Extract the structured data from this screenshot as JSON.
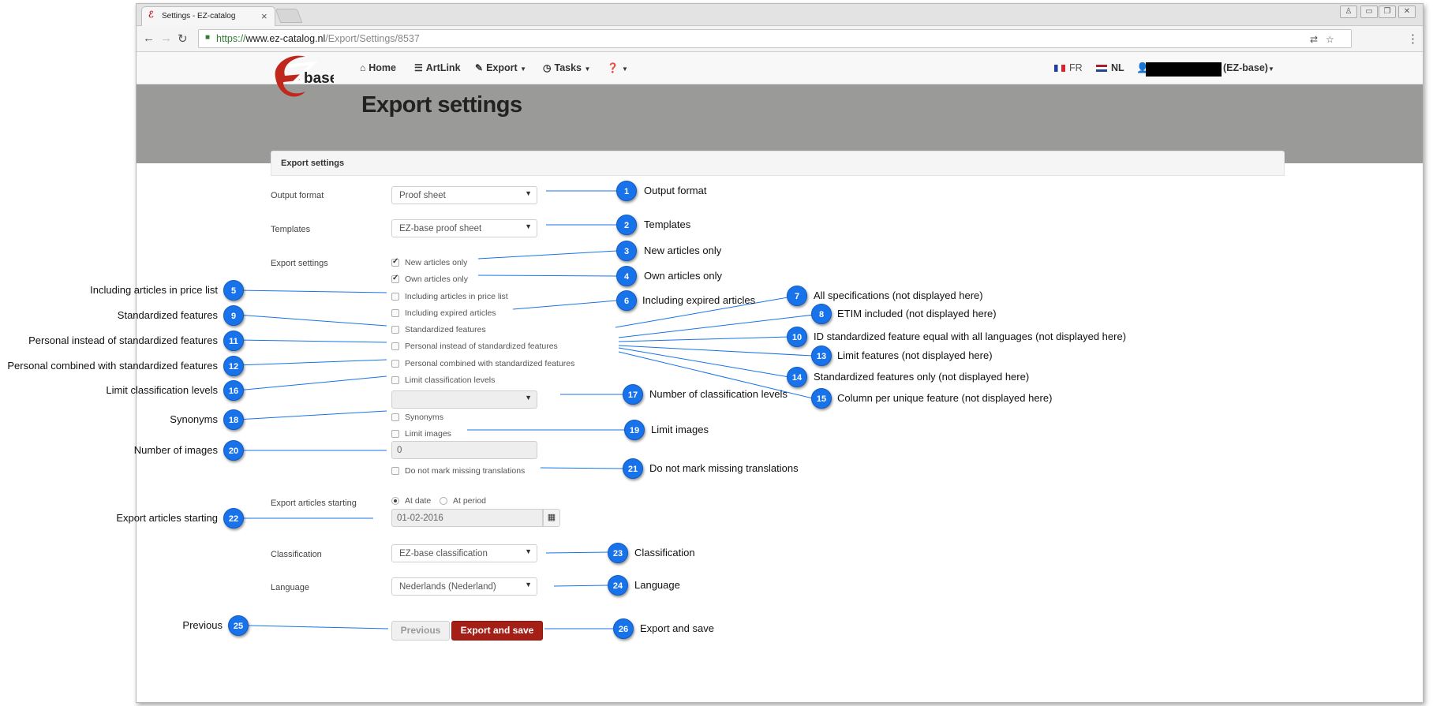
{
  "browser": {
    "tab_title": "Settings - EZ-catalog",
    "tab_close": "×",
    "url_https": "https://",
    "url_host": "www.ez-catalog.nl",
    "url_path": "/Export/Settings/8537"
  },
  "site": {
    "logo_text": "base",
    "nav": {
      "home": "Home",
      "artlink": "ArtLink",
      "export": "Export",
      "tasks": "Tasks",
      "help": ""
    },
    "lang_fr": "FR",
    "lang_nl": "NL",
    "user_suffix": "(EZ-base)"
  },
  "page": {
    "title": "Export settings",
    "panel_title": "Export settings"
  },
  "form": {
    "output_format_label": "Output format",
    "output_format_value": "Proof sheet",
    "templates_label": "Templates",
    "templates_value": "EZ-base proof sheet",
    "export_settings_label": "Export settings",
    "checkboxes": {
      "new_articles_only": {
        "label": "New articles only",
        "checked": true
      },
      "own_articles_only": {
        "label": "Own articles only",
        "checked": true
      },
      "including_price_list": {
        "label": "Including articles in price list",
        "checked": false
      },
      "including_expired": {
        "label": "Including expired articles",
        "checked": false
      },
      "standardized_features": {
        "label": "Standardized features",
        "checked": false
      },
      "personal_instead": {
        "label": "Personal instead of standardized features",
        "checked": false
      },
      "personal_combined": {
        "label": "Personal combined with standardized features",
        "checked": false
      },
      "limit_classification": {
        "label": "Limit classification levels",
        "checked": false
      },
      "synonyms": {
        "label": "Synonyms",
        "checked": false
      },
      "limit_images": {
        "label": "Limit images",
        "checked": false
      },
      "no_mark_missing": {
        "label": "Do not mark missing translations",
        "checked": false
      }
    },
    "classification_levels_value": "",
    "number_of_images_value": "0",
    "export_articles_starting_label": "Export articles starting",
    "radio_at_date": "At date",
    "radio_at_period": "At period",
    "date_value": "01-02-2016",
    "classification_label": "Classification",
    "classification_value": "EZ-base classification",
    "language_label": "Language",
    "language_value": "Nederlands (Nederland)",
    "previous_label": "Previous",
    "export_label": "Export and save"
  },
  "callouts": {
    "c1": {
      "num": "1",
      "text": "Output format"
    },
    "c2": {
      "num": "2",
      "text": "Templates"
    },
    "c3": {
      "num": "3",
      "text": "New articles only"
    },
    "c4": {
      "num": "4",
      "text": "Own articles only"
    },
    "c5": {
      "num": "5",
      "text": "Including articles in price list"
    },
    "c6": {
      "num": "6",
      "text": "Including expired articles"
    },
    "c7": {
      "num": "7",
      "text": "All specifications (not displayed here)"
    },
    "c8": {
      "num": "8",
      "text": "ETIM included (not displayed here)"
    },
    "c9": {
      "num": "9",
      "text": "Standardized features"
    },
    "c10": {
      "num": "10",
      "text": "ID standardized feature equal with all languages (not displayed here)"
    },
    "c11": {
      "num": "11",
      "text": "Personal instead of standardized features"
    },
    "c12": {
      "num": "12",
      "text": "Personal combined with standardized features"
    },
    "c13": {
      "num": "13",
      "text": "Limit features (not displayed here)"
    },
    "c14": {
      "num": "14",
      "text": "Standardized features only (not displayed here)"
    },
    "c15": {
      "num": "15",
      "text": "Column per unique feature (not displayed here)"
    },
    "c16": {
      "num": "16",
      "text": "Limit classification levels"
    },
    "c17": {
      "num": "17",
      "text": "Number of classification levels"
    },
    "c18": {
      "num": "18",
      "text": "Synonyms"
    },
    "c19": {
      "num": "19",
      "text": "Limit images"
    },
    "c20": {
      "num": "20",
      "text": "Number of images"
    },
    "c21": {
      "num": "21",
      "text": "Do not mark missing translations"
    },
    "c22": {
      "num": "22",
      "text": "Export articles starting"
    },
    "c23": {
      "num": "23",
      "text": "Classification"
    },
    "c24": {
      "num": "24",
      "text": "Language"
    },
    "c25": {
      "num": "25",
      "text": "Previous"
    },
    "c26": {
      "num": "26",
      "text": "Export and save"
    }
  },
  "colors": {
    "callout_blue": "#1873ea",
    "export_button_red": "#a42016",
    "header_grey": "#9a9b98",
    "https_green": "#2e7d32"
  }
}
